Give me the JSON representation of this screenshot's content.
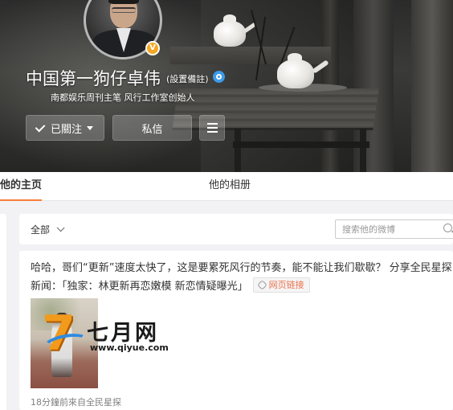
{
  "profile": {
    "name": "中国第一狗仔卓伟",
    "remark": "(設置備註)",
    "bio": "南都娱乐周刊主笔 风行工作室创始人",
    "verified_badge": "V"
  },
  "actions": {
    "follow_label": "已關注",
    "message_label": "私信"
  },
  "tabs": [
    {
      "label": "他的主页",
      "active": true
    },
    {
      "label": "他的相册",
      "active": false
    }
  ],
  "filter": {
    "scope_label": "全部",
    "search_placeholder": "搜索他的微博"
  },
  "post": {
    "text": "哈哈，哥们“更新”速度太快了，这是要累死风行的节奏，能不能让我们歇歇？ 分享全民星探新闻：「独家：林更新再恋嫩模 新恋情疑曝光」",
    "link_label": "网页链接",
    "meta": "18分鐘前來自全民星探"
  },
  "watermark": {
    "glyph": "7",
    "name": "七月网",
    "url": "www.qiyue.com"
  },
  "colors": {
    "accent": "#fa7d3c",
    "link": "#eb7350",
    "verified": "#f5a623",
    "gender": "#3d9be9"
  }
}
